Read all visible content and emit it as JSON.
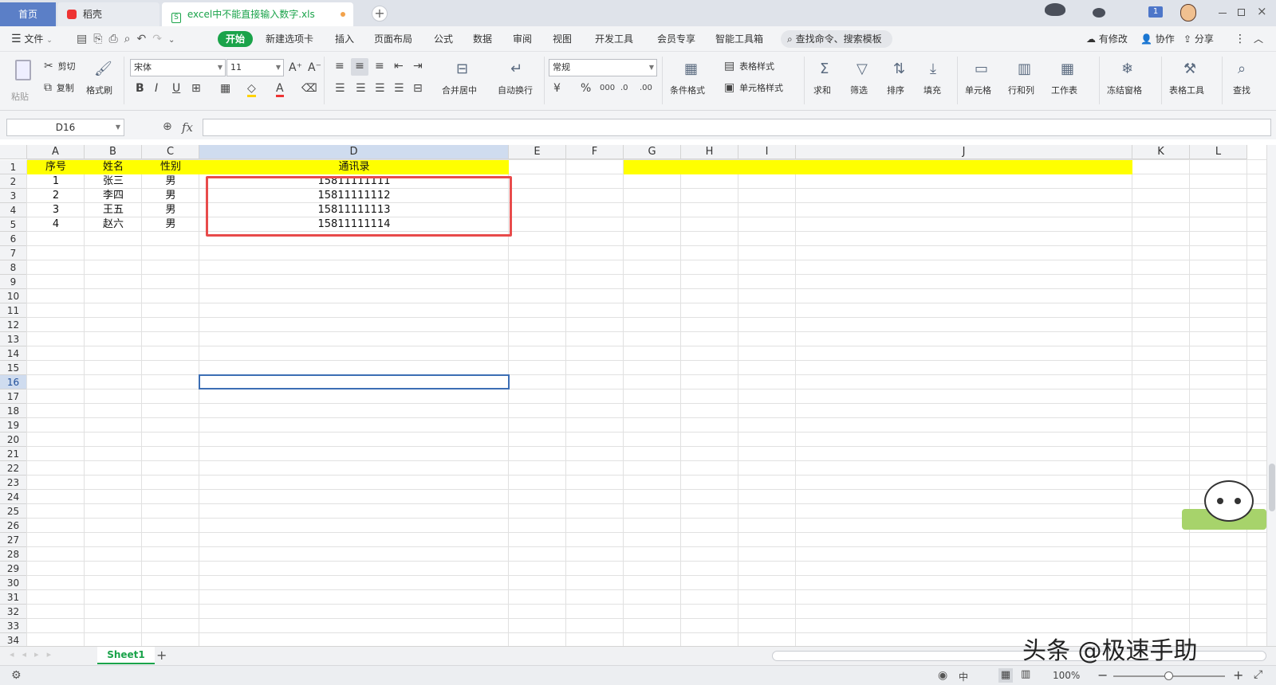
{
  "tabs": {
    "home": "首页",
    "docer": "稻壳",
    "file": "excel中不能直接输入数字.xls",
    "add": "+"
  },
  "window": {
    "badge": "1"
  },
  "menu": {
    "file": "文件",
    "items": [
      "开始",
      "新建选项卡",
      "插入",
      "页面布局",
      "公式",
      "数据",
      "审阅",
      "视图",
      "开发工具",
      "会员专享",
      "智能工具箱"
    ],
    "search": "查找命令、搜索模板",
    "modified": "有修改",
    "collab": "协作",
    "share": "分享"
  },
  "ribbon": {
    "paste": "粘贴",
    "cut": "剪切",
    "copy": "复制",
    "format_painter": "格式刷",
    "font_name": "宋体",
    "font_size": "11",
    "merge_center": "合并居中",
    "auto_wrap": "自动换行",
    "number_format": "常规",
    "conditional_format": "条件格式",
    "table_style": "表格样式",
    "cell_style": "单元格样式",
    "sum": "求和",
    "filter": "筛选",
    "sort": "排序",
    "fill": "填充",
    "cell": "单元格",
    "row_col": "行和列",
    "worksheet": "工作表",
    "freeze": "冻结窗格",
    "table_tools": "表格工具",
    "find": "查找"
  },
  "formula_bar": {
    "name_box": "D16",
    "fx": "fx",
    "content": ""
  },
  "grid": {
    "columns": [
      "A",
      "B",
      "C",
      "D",
      "E",
      "F",
      "G",
      "H",
      "I",
      "J",
      "K",
      "L"
    ],
    "rows": [
      "1",
      "2",
      "3",
      "4",
      "5",
      "6",
      "7",
      "8",
      "9",
      "10",
      "11",
      "12",
      "13",
      "14",
      "15",
      "16",
      "17",
      "18",
      "19",
      "20",
      "21",
      "22",
      "23",
      "24",
      "25",
      "26",
      "27",
      "28",
      "29",
      "30",
      "31",
      "32",
      "33",
      "34"
    ],
    "header": [
      "序号",
      "姓名",
      "性别",
      "通讯录"
    ],
    "data": [
      [
        "1",
        "张三",
        "男",
        "15811111111"
      ],
      [
        "2",
        "李四",
        "男",
        "15811111112"
      ],
      [
        "3",
        "王五",
        "男",
        "15811111113"
      ],
      [
        "4",
        "赵六",
        "男",
        "15811111114"
      ]
    ],
    "header_fill": "#ffff00",
    "highlight_color": "#e84b4b",
    "selected_cell": "D16"
  },
  "sheets": {
    "active": "Sheet1",
    "add": "+"
  },
  "status": {
    "zoom": "100%",
    "input_mode": "中"
  },
  "watermark": "头条 @极速手助",
  "colors": {
    "accent": "#1aa34a",
    "selection": "#3c6eb4"
  }
}
